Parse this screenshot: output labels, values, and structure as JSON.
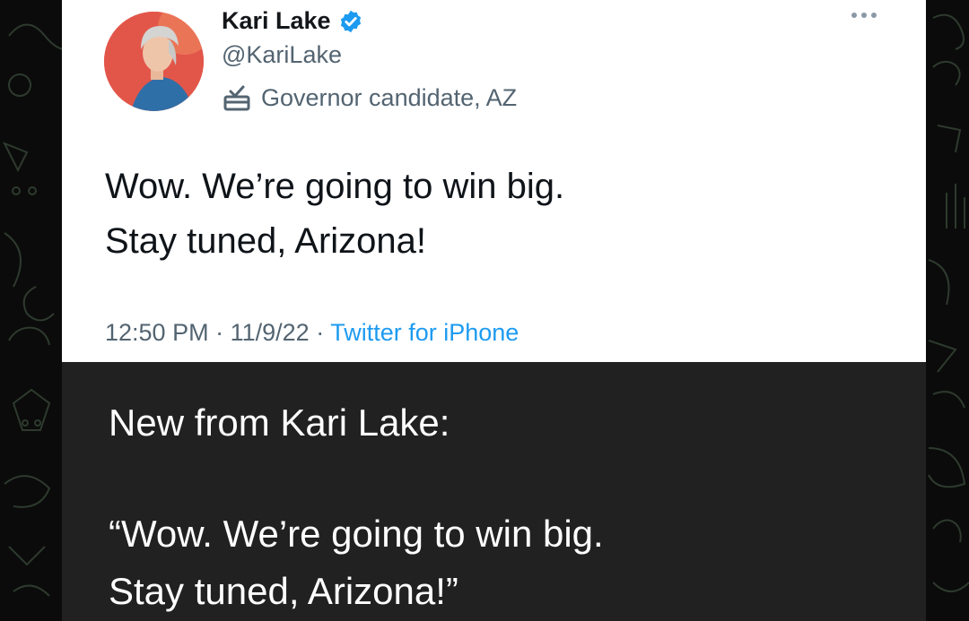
{
  "tweet": {
    "name": "Kari Lake",
    "handle": "@KariLake",
    "label": "Governor candidate, AZ",
    "text_lines": [
      "Wow. We’re going to win big.",
      "Stay tuned, Arizona!"
    ],
    "time": "12:50 PM",
    "date": "11/9/22",
    "source": "Twitter for iPhone",
    "separator": "·"
  },
  "caption": {
    "line1": "New from Kari Lake:",
    "line2": "“Wow. We’re going to win big.",
    "line3": "Stay tuned, Arizona!”"
  },
  "icons": {
    "verified": "verified-badge-icon",
    "label": "ballot-box-icon",
    "more": "more-options-icon"
  },
  "colors": {
    "accent": "#1d9bf0",
    "caption_bg": "#212121",
    "wallpaper_bg": "#0b0b0b"
  }
}
